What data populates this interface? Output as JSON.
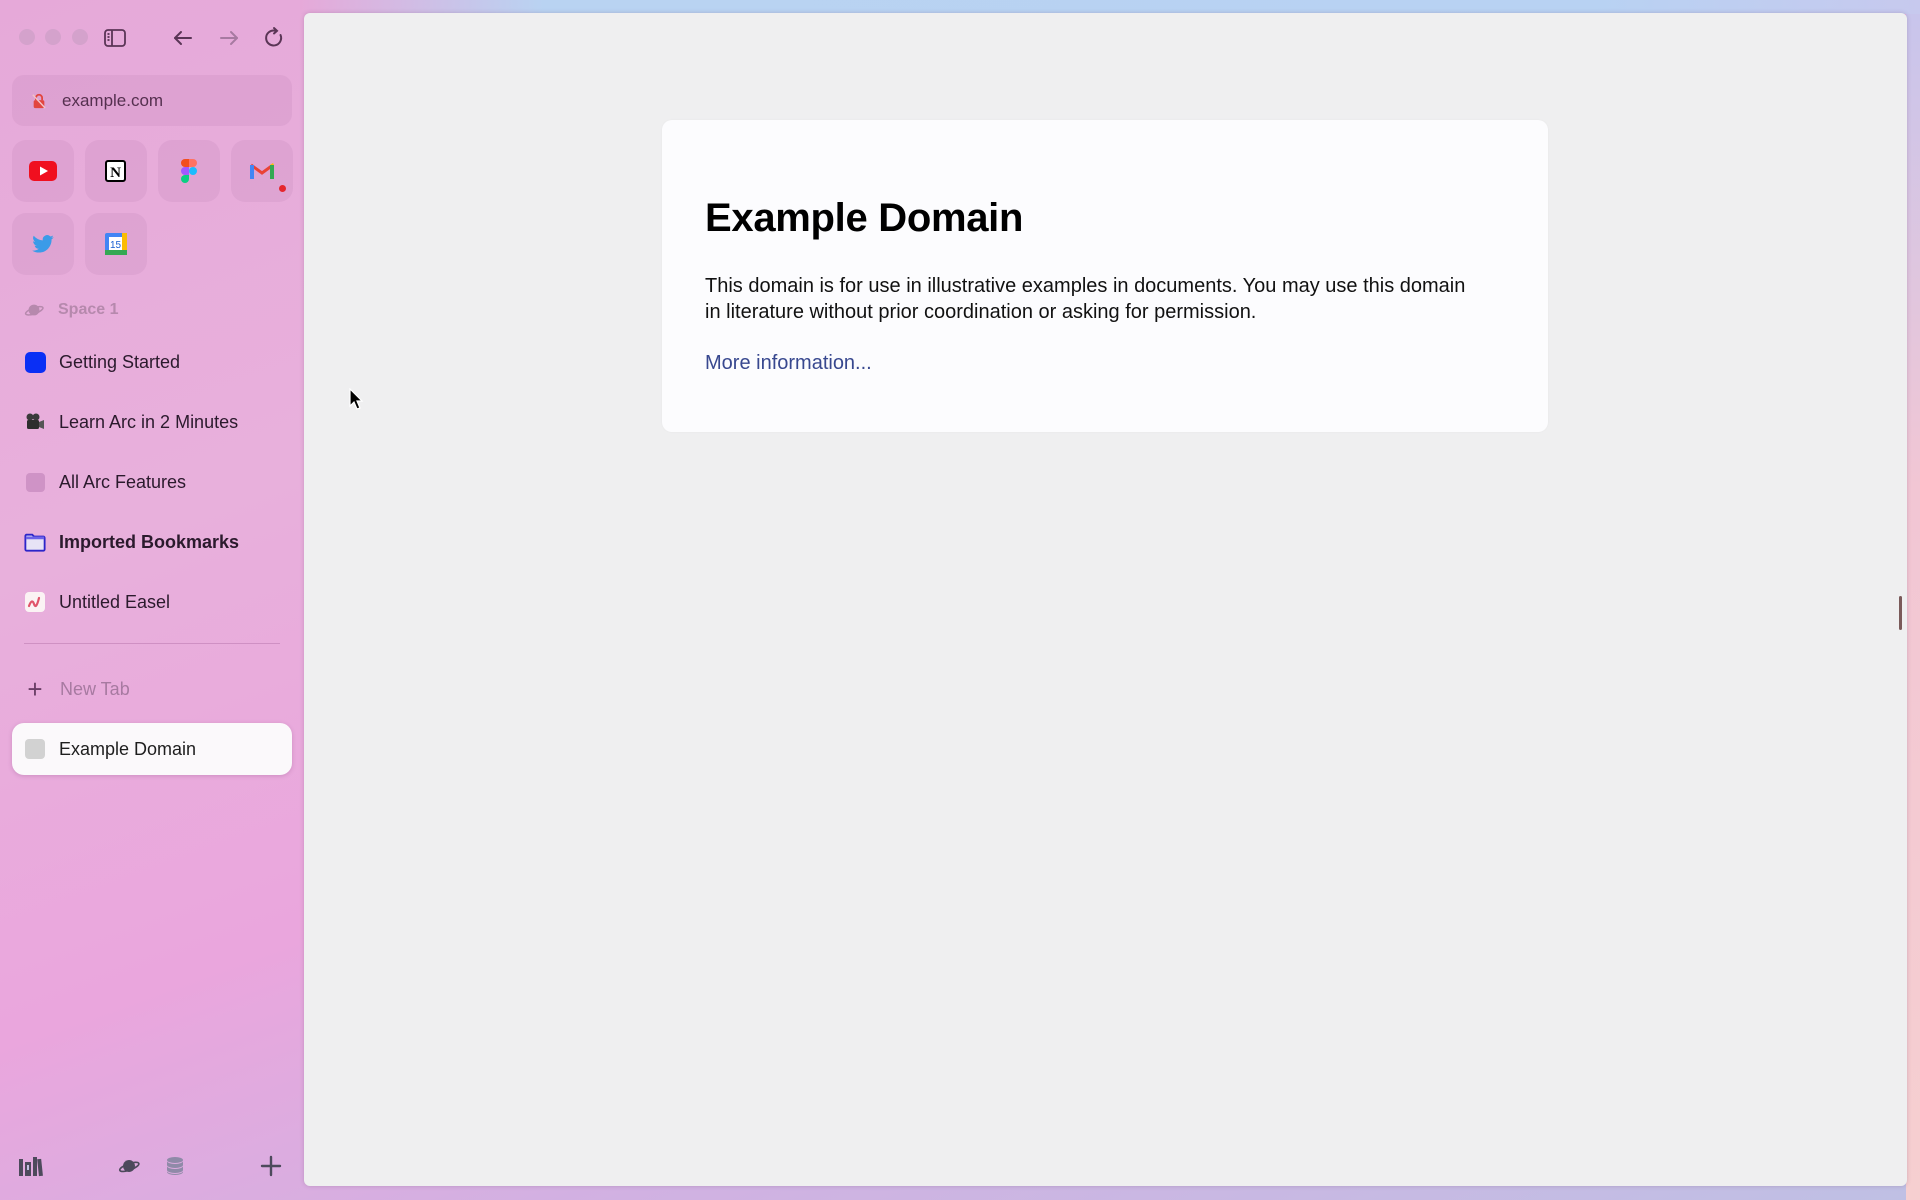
{
  "window": {
    "traffic_lights": [
      "close",
      "minimize",
      "zoom"
    ]
  },
  "toolbar": {
    "sidebar_toggle_icon": "sidebar-icon",
    "back_icon": "arrow-left-icon",
    "forward_icon": "arrow-right-icon",
    "reload_icon": "reload-icon"
  },
  "urlbar": {
    "url": "example.com",
    "security_icon": "insecure-lock-icon"
  },
  "favorites": [
    {
      "name": "YouTube",
      "icon": "youtube-icon"
    },
    {
      "name": "Notion",
      "icon": "notion-icon"
    },
    {
      "name": "Figma",
      "icon": "figma-icon"
    },
    {
      "name": "Gmail",
      "icon": "gmail-icon",
      "badge": true
    },
    {
      "name": "Twitter",
      "icon": "twitter-icon"
    },
    {
      "name": "Google Calendar",
      "icon": "calendar-icon",
      "day": "15"
    }
  ],
  "space": {
    "label": "Space 1",
    "icon": "planet-icon"
  },
  "pinned": [
    {
      "label": "Getting Started",
      "icon": "blue-square-icon",
      "color": "#0a2ff5"
    },
    {
      "label": "Learn Arc in 2 Minutes",
      "icon": "video-camera-icon"
    },
    {
      "label": "All Arc Features",
      "icon": "muted-square-icon",
      "color": "#cf93c6"
    },
    {
      "label": "Imported Bookmarks",
      "icon": "folder-icon",
      "bold": true,
      "color": "#2c25c9"
    },
    {
      "label": "Untitled Easel",
      "icon": "easel-icon"
    }
  ],
  "new_tab": {
    "label": "New Tab"
  },
  "tabs": [
    {
      "label": "Example Domain",
      "active": true
    }
  ],
  "bottom_bar": {
    "library_icon": "library-icon",
    "space_icon": "planet-icon",
    "archive_icon": "archive-icon",
    "new_space_icon": "plus-icon"
  },
  "page": {
    "heading": "Example Domain",
    "paragraph": "This domain is for use in illustrative examples in documents. You may use this domain in literature without prior coordination or asking for permission.",
    "link": "More information...",
    "link_color": "#38488f"
  }
}
